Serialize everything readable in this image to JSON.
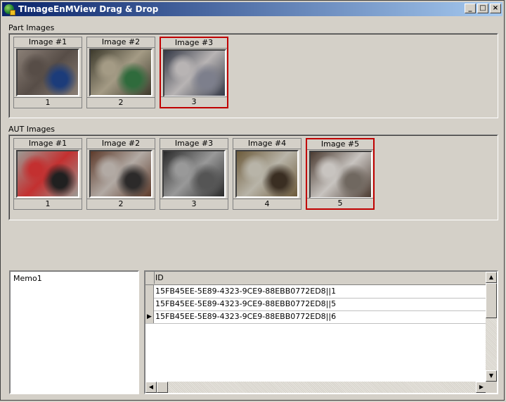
{
  "window": {
    "title": "TImageEnMView Drag & Drop",
    "buttons": [
      "_",
      "□",
      "×"
    ]
  },
  "part_images": {
    "label": "Part Images",
    "items": [
      {
        "caption": "Image #1",
        "number": "1",
        "selected": false,
        "colors": [
          "#8a7f76",
          "#574d47",
          "#1c3c7a"
        ]
      },
      {
        "caption": "Image #2",
        "number": "2",
        "selected": false,
        "colors": [
          "#3d3a2c",
          "#a49b85",
          "#2f6b3c"
        ]
      },
      {
        "caption": "Image #3",
        "number": "3",
        "selected": true,
        "colors": [
          "#343946",
          "#b8b4b4",
          "#7d7f8c"
        ]
      }
    ]
  },
  "aut_images": {
    "label": "AUT Images",
    "items": [
      {
        "caption": "Image #1",
        "number": "1",
        "selected": false,
        "colors": [
          "#9c9a94",
          "#c33030",
          "#202020"
        ]
      },
      {
        "caption": "Image #2",
        "number": "2",
        "selected": false,
        "colors": [
          "#5d3a2a",
          "#b2aaa4",
          "#2c2a2a"
        ]
      },
      {
        "caption": "Image #3",
        "number": "3",
        "selected": false,
        "colors": [
          "#2a2a2a",
          "#999999",
          "#555555"
        ]
      },
      {
        "caption": "Image #4",
        "number": "4",
        "selected": false,
        "colors": [
          "#6c5a3a",
          "#b8b4a8",
          "#3a2e22"
        ]
      },
      {
        "caption": "Image #5",
        "number": "5",
        "selected": true,
        "colors": [
          "#4a3a30",
          "#c8c4c0",
          "#706860"
        ]
      }
    ]
  },
  "memo": {
    "text": "Memo1"
  },
  "grid": {
    "column": "ID",
    "rows": [
      {
        "value": "15FB45EE-5E89-4323-9CE9-88EBB0772ED8||1",
        "current": false
      },
      {
        "value": "15FB45EE-5E89-4323-9CE9-88EBB0772ED8||5",
        "current": false
      },
      {
        "value": "15FB45EE-5E89-4323-9CE9-88EBB0772ED8||6",
        "current": true
      }
    ]
  }
}
